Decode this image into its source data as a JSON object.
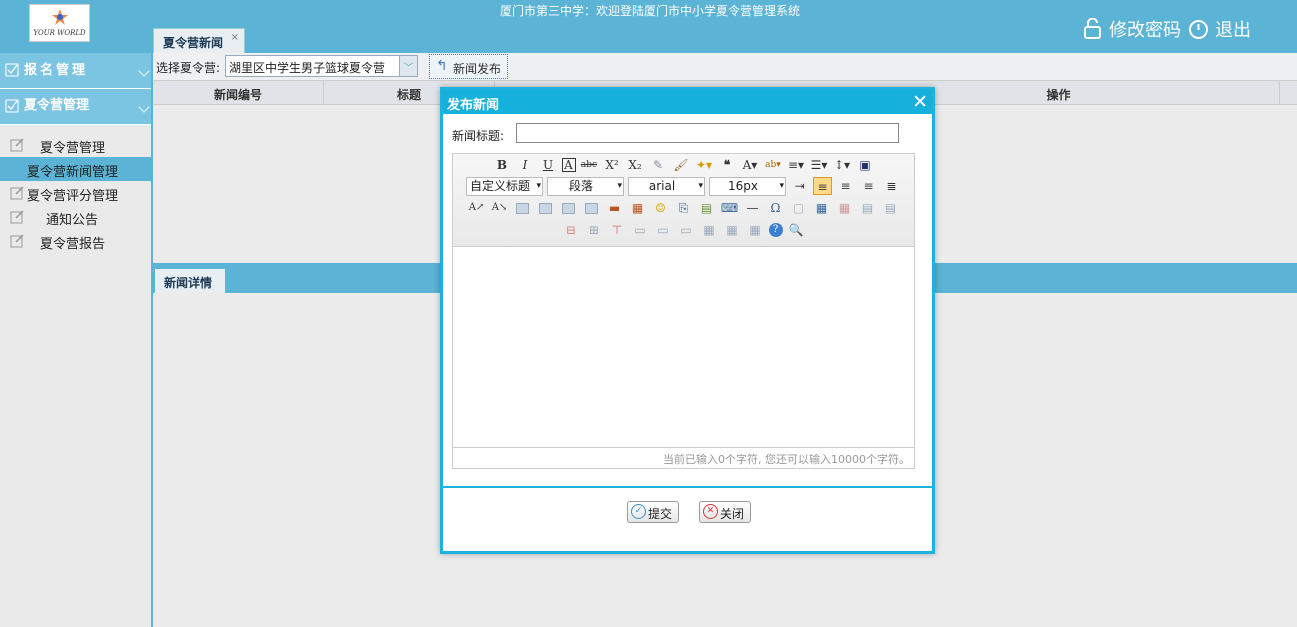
{
  "app": {
    "site_title": "厦门市第三中学：欢迎登陆厦门市中小学夏令营管理系统",
    "logo_text": "YOUR WORLD",
    "change_password": "修改密码",
    "logout": "退出"
  },
  "tab": {
    "label": "夏令营新闻",
    "close": "×"
  },
  "sidebar": {
    "sections": [
      {
        "label": "报名管理"
      },
      {
        "label": "夏令营管理"
      }
    ],
    "items": [
      {
        "label": "夏令营管理"
      },
      {
        "label": "夏令营新闻管理"
      },
      {
        "label": "夏令营评分管理"
      },
      {
        "label": "通知公告"
      },
      {
        "label": "夏令营报告"
      }
    ]
  },
  "toolbar": {
    "select_label": "选择夏令营:",
    "select_value": "湖里区中学生男子篮球夏令营",
    "publish_button": "新闻发布"
  },
  "grid": {
    "columns": [
      "新闻编号",
      "标题",
      "操作"
    ]
  },
  "detail": {
    "tab_label": "新闻详情"
  },
  "modal": {
    "title": "发布新闻",
    "field_label": "新闻标题:",
    "title_value": "",
    "editor": {
      "custom_heading": "自定义标题",
      "paragraph": "段落",
      "font": "arial",
      "size": "16px",
      "status": "当前已输入0个字符, 您还可以输入10000个字符。"
    },
    "submit": "提交",
    "close": "关闭"
  },
  "colors": {
    "accent": "#5bb3d6",
    "modal_border": "#1cb2dd"
  }
}
